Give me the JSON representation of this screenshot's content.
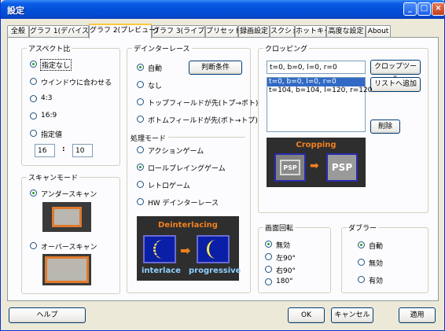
{
  "window": {
    "title": "設定",
    "minimize_label": "_",
    "maximize_label": "□",
    "close_label": "×"
  },
  "tabs": [
    {
      "label": "全般",
      "active": false
    },
    {
      "label": "グラフ 1(デバイス)",
      "active": false
    },
    {
      "label": "グラフ 2(プレビュー)",
      "active": true
    },
    {
      "label": "グラフ 3(ライブ)",
      "active": false
    },
    {
      "label": "プリセット",
      "active": false
    },
    {
      "label": "録画設定",
      "active": false
    },
    {
      "label": "スクショ",
      "active": false
    },
    {
      "label": "ホットキー",
      "active": false
    },
    {
      "label": "高度な設定",
      "active": false
    },
    {
      "label": "About",
      "active": false
    }
  ],
  "aspect": {
    "legend": "アスペクト比",
    "options": [
      "指定なし",
      "ウインドウに合わせる",
      "4:3",
      "16:9",
      "指定値"
    ],
    "selected_index": 0,
    "width_value": "16",
    "separator": ":",
    "height_value": "10"
  },
  "scan": {
    "legend": "スキャンモード",
    "options": [
      "アンダースキャン",
      "オーバースキャン"
    ],
    "selected_index": 0
  },
  "deinterlace": {
    "legend": "デインターレース",
    "options": [
      "自動",
      "なし",
      "トップフィールドが先(トプ→ボト)",
      "ボトムフィールドが先(ボト→トプ)"
    ],
    "selected_index": 0,
    "criteria_button": "判断条件"
  },
  "processing": {
    "legend": "処理モード",
    "options": [
      "アクションゲーム",
      "ロールプレイングゲーム",
      "レトロゲーム",
      "HW デインターレース"
    ],
    "selected_index": 1
  },
  "deinterlace_image": {
    "title": "Deinterlacing",
    "left_label": "interlace",
    "right_label": "progressive"
  },
  "cropping": {
    "legend": "クロッピング",
    "input_value": "t=0, b=0, l=0, r=0",
    "crop_tool_button": "クロップツール",
    "add_to_list_button": "リストへ追加",
    "delete_button": "削除",
    "list": [
      "t=0, b=0, l=0, r=0",
      "t=104, b=104, l=120, r=120"
    ],
    "selected_index": 0,
    "image": {
      "title": "Cropping",
      "left_label": "PSP",
      "right_label": "PSP"
    }
  },
  "rotation": {
    "legend": "画面回転",
    "options": [
      "無効",
      "左90°",
      "右90°",
      "180°"
    ],
    "selected_index": 0
  },
  "dubbler": {
    "legend": "ダブラー",
    "options": [
      "自動",
      "無効",
      "有効"
    ],
    "selected_index": 0
  },
  "footer": {
    "help_button": "ヘルプ",
    "ok_button": "OK",
    "cancel_button": "キャンセル",
    "apply_button": "適用"
  },
  "colors": {
    "title_blue": "#0250d8",
    "dialog_bg": "#ece9d8",
    "radio_green": "#21a121",
    "preview_bg": "#2e2e2e",
    "orange_title": "#f2801e",
    "selection_blue": "#316ac5"
  }
}
